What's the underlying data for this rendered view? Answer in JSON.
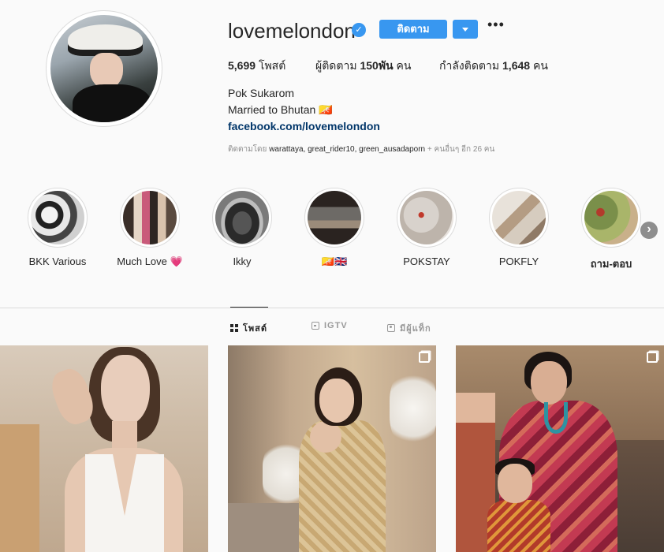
{
  "profile": {
    "username": "lovemelondon",
    "verified_mark": "✓",
    "follow_label": "ติดตาม",
    "more_label": "•••",
    "posts_count": "5,699",
    "posts_label": "โพสต์",
    "followers_label": "ผู้ติดตาม",
    "followers_count": "150พัน",
    "followers_unit": "คน",
    "following_label": "กำลังติดตาม",
    "following_count": "1,648",
    "following_unit": "คน",
    "full_name": "Pok Sukarom",
    "bio": "Married to Bhutan 🇧🇹",
    "link": "facebook.com/lovemelondon",
    "followed_by_prefix": "ติดตามโดย",
    "followed_by_names": "warattaya, great_rider10, green_ausadaporn",
    "followed_by_suffix": "+ คนอื่นๆ อีก 26 คน"
  },
  "highlights": [
    {
      "label": "BKK Various"
    },
    {
      "label": "Much Love 💗"
    },
    {
      "label": "Ikky"
    },
    {
      "label": "🇧🇹🇬🇧"
    },
    {
      "label": "POKSTAY"
    },
    {
      "label": "POKFLY"
    },
    {
      "label": "ถาม-ตอบ"
    }
  ],
  "highlights_next": "›",
  "tabs": [
    {
      "label": "โพสต์",
      "icon": "grid-icon"
    },
    {
      "label": "IGTV",
      "icon": "igtv-icon"
    },
    {
      "label": "มีผู้แท็ก",
      "icon": "tag-icon"
    }
  ],
  "colors": {
    "accent": "#3897f0",
    "link": "#003569",
    "muted": "#8e8e8e",
    "border": "#dbdbdb"
  }
}
